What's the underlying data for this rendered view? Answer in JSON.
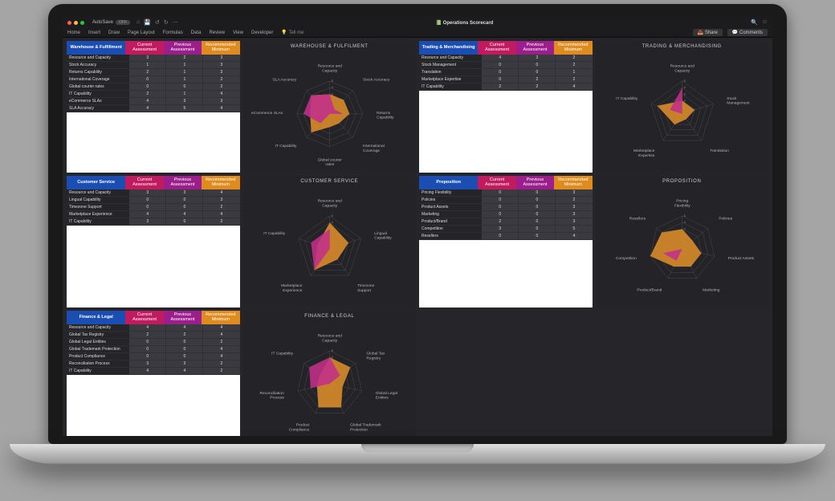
{
  "titlebar": {
    "autosave": "AutoSave",
    "autosave_state": "OFF",
    "doc_icon": "📗",
    "doc_title": "Operations Scorecard"
  },
  "ribbon": {
    "tabs": [
      "Home",
      "Insert",
      "Draw",
      "Page Layout",
      "Formulas",
      "Data",
      "Review",
      "View",
      "Developer"
    ],
    "tellme": "Tell me",
    "share": "Share",
    "comments": "Comments"
  },
  "columns": {
    "current": "Current\nAssessment",
    "previous": "Previous\nAssessment",
    "minimum": "Recommended\nMinimum"
  },
  "sections": [
    {
      "title": "Warehouse & Fulfillment",
      "radar_title": "WAREHOUSE & FULFILMENT",
      "rows": [
        {
          "label": "Resource and Capacity",
          "cur": 3,
          "prev": 2,
          "min": 3
        },
        {
          "label": "Stock Accuracy",
          "cur": 1,
          "prev": 1,
          "min": 3
        },
        {
          "label": "Returns Capability",
          "cur": 2,
          "prev": 1,
          "min": 3
        },
        {
          "label": "International Coverage",
          "cur": 0,
          "prev": 1,
          "min": 2
        },
        {
          "label": "Global courier rates",
          "cur": 0,
          "prev": 0,
          "min": 2
        },
        {
          "label": "IT Capability",
          "cur": 2,
          "prev": 1,
          "min": 4
        },
        {
          "label": "eCommerce SLAs",
          "cur": 4,
          "prev": 3,
          "min": 3
        },
        {
          "label": "SLA Accuracy",
          "cur": 4,
          "prev": 5,
          "min": 4
        }
      ]
    },
    {
      "title": "Trading & Merchandising",
      "radar_title": "TRADING & MERCHANDISING",
      "rows": [
        {
          "label": "Resource and Capacity",
          "cur": 4,
          "prev": 3,
          "min": 2
        },
        {
          "label": "Stock Management",
          "cur": 0,
          "prev": 0,
          "min": 2
        },
        {
          "label": "Translation",
          "cur": 0,
          "prev": 0,
          "min": 1
        },
        {
          "label": "Marketplace Expertise",
          "cur": 0,
          "prev": 2,
          "min": 2
        },
        {
          "label": "IT Capability",
          "cur": 2,
          "prev": 2,
          "min": 4
        }
      ]
    },
    {
      "title": "Customer Service",
      "radar_title": "CUSTOMER SERVICE",
      "rows": [
        {
          "label": "Resource and Capacity",
          "cur": 3,
          "prev": 3,
          "min": 4
        },
        {
          "label": "Lingual Capability",
          "cur": 0,
          "prev": 0,
          "min": 3
        },
        {
          "label": "Timezone Support",
          "cur": 0,
          "prev": 0,
          "min": 2
        },
        {
          "label": "Marketplace Experience",
          "cur": 4,
          "prev": 4,
          "min": 4
        },
        {
          "label": "IT Capability",
          "cur": 3,
          "prev": 0,
          "min": 2
        }
      ]
    },
    {
      "title": "Proposition",
      "radar_title": "PROPOSITION",
      "rows": [
        {
          "label": "Pricing Flexibility",
          "cur": 0,
          "prev": 0,
          "min": 3
        },
        {
          "label": "Policies",
          "cur": 0,
          "prev": 0,
          "min": 2
        },
        {
          "label": "Product Assets",
          "cur": 0,
          "prev": 0,
          "min": 3
        },
        {
          "label": "Marketing",
          "cur": 0,
          "prev": 0,
          "min": 3
        },
        {
          "label": "Product/Brand",
          "cur": 2,
          "prev": 0,
          "min": 3
        },
        {
          "label": "Competition",
          "cur": 3,
          "prev": 0,
          "min": 5
        },
        {
          "label": "Resellers",
          "cur": 0,
          "prev": 0,
          "min": 4
        }
      ]
    },
    {
      "title": "Finance & Legal",
      "radar_title": "FINANCE & LEGAL",
      "rows": [
        {
          "label": "Resource and Capacity",
          "cur": 4,
          "prev": 4,
          "min": 4
        },
        {
          "label": "Global Tax Registry",
          "cur": 2,
          "prev": 2,
          "min": 4
        },
        {
          "label": "Global Legal Entities",
          "cur": 0,
          "prev": 0,
          "min": 2
        },
        {
          "label": "Global Trademark Protection",
          "cur": 0,
          "prev": 0,
          "min": 4
        },
        {
          "label": "Product Compliance",
          "cur": 0,
          "prev": 0,
          "min": 4
        },
        {
          "label": "Reconciliation Process",
          "cur": 3,
          "prev": 3,
          "min": 2
        },
        {
          "label": "IT Capability",
          "cur": 4,
          "prev": 4,
          "min": 2
        }
      ]
    }
  ],
  "chart_data": [
    {
      "type": "radar",
      "title": "WAREHOUSE & FULFILMENT",
      "axes": [
        "Resource and Capacity",
        "Stock Accuracy",
        "Returns Capability",
        "International Coverage",
        "Global courier rates",
        "IT Capability",
        "eCommerce SLAs",
        "SLA Accuracy"
      ],
      "range": [
        0,
        5
      ],
      "series": [
        {
          "name": "Recommended Minimum",
          "values": [
            3,
            3,
            3,
            2,
            2,
            4,
            3,
            4
          ]
        },
        {
          "name": "Current Assessment",
          "values": [
            3,
            1,
            2,
            0,
            0,
            2,
            4,
            4
          ]
        }
      ]
    },
    {
      "type": "radar",
      "title": "TRADING & MERCHANDISING",
      "axes": [
        "Resource and Capacity",
        "Stock Management",
        "Translation",
        "Marketplace Expertise",
        "IT Capability"
      ],
      "range": [
        0,
        5
      ],
      "series": [
        {
          "name": "Recommended Minimum",
          "values": [
            2,
            2,
            1,
            2,
            4
          ]
        },
        {
          "name": "Current Assessment",
          "values": [
            4,
            0,
            0,
            0,
            2
          ]
        }
      ]
    },
    {
      "type": "radar",
      "title": "CUSTOMER SERVICE",
      "axes": [
        "Resource and Capacity",
        "Lingual Capability",
        "Timezone Support",
        "Marketplace Experience",
        "IT Capability"
      ],
      "range": [
        0,
        5
      ],
      "series": [
        {
          "name": "Recommended Minimum",
          "values": [
            4,
            3,
            2,
            4,
            2
          ]
        },
        {
          "name": "Current Assessment",
          "values": [
            3,
            0,
            0,
            4,
            3
          ]
        }
      ]
    },
    {
      "type": "radar",
      "title": "PROPOSITION",
      "axes": [
        "Pricing Flexibility",
        "Policies",
        "Product Assets",
        "Marketing",
        "Product/Brand",
        "Competition",
        "Resellers"
      ],
      "range": [
        0,
        5
      ],
      "series": [
        {
          "name": "Recommended Minimum",
          "values": [
            3,
            2,
            3,
            3,
            3,
            5,
            4
          ]
        },
        {
          "name": "Current Assessment",
          "values": [
            0,
            0,
            0,
            0,
            2,
            3,
            0
          ]
        }
      ]
    },
    {
      "type": "radar",
      "title": "FINANCE & LEGAL",
      "axes": [
        "Resource and Capacity",
        "Global Tax Registry",
        "Global Legal Entities",
        "Global Trademark Protection",
        "Product Compliance",
        "Reconciliation Process",
        "IT Capability"
      ],
      "range": [
        0,
        5
      ],
      "series": [
        {
          "name": "Recommended Minimum",
          "values": [
            4,
            4,
            2,
            4,
            4,
            2,
            2
          ]
        },
        {
          "name": "Current Assessment",
          "values": [
            4,
            2,
            0,
            0,
            0,
            3,
            4
          ]
        }
      ]
    }
  ]
}
